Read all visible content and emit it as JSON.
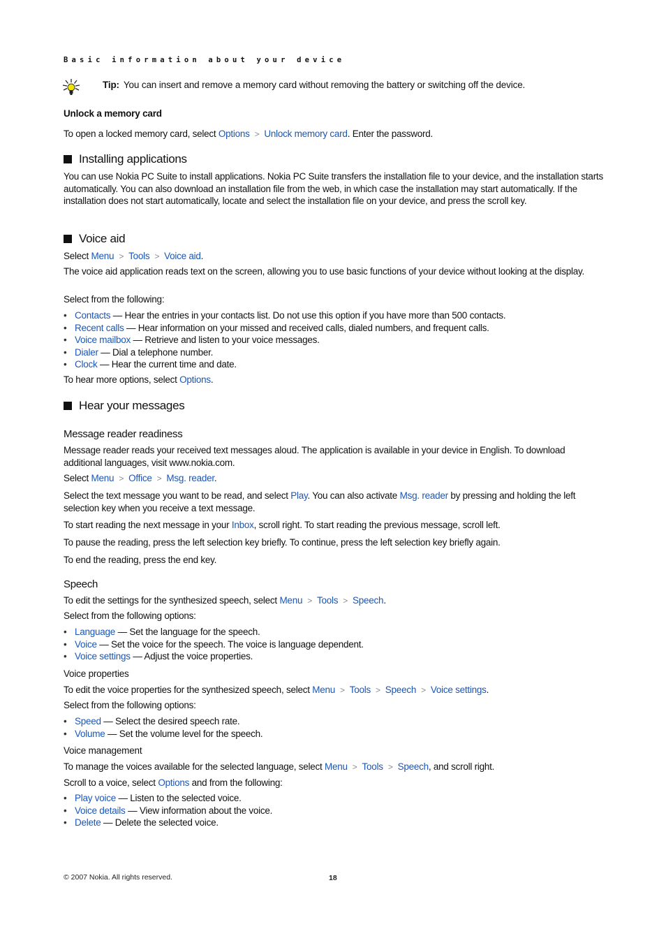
{
  "running_head": "Basic information about your device",
  "tip": {
    "icon": "lightbulb-icon",
    "label": "Tip:",
    "text": "You can insert and remove a memory card without removing the battery or switching off the device."
  },
  "unlock": {
    "heading": "Unlock a memory card",
    "pre": "To open a locked memory card, select ",
    "path": [
      "Options",
      "Unlock memory card"
    ],
    "post": ". Enter the password."
  },
  "installing": {
    "heading": "Installing applications",
    "body": "You can use Nokia PC Suite to install applications. Nokia PC Suite transfers the installation file to your device, and the installation starts automatically. You can also download an installation file from the web, in which case the installation may start automatically. If the installation does not start automatically, locate and select the installation file on your device, and press the scroll key."
  },
  "voice_aid": {
    "heading": "Voice aid",
    "select_pre": "Select ",
    "path": [
      "Menu",
      "Tools",
      "Voice aid"
    ],
    "select_post": ".",
    "description": "The voice aid application reads text on the screen, allowing you to use basic functions of your device without looking at the display.",
    "select_from": "Select from the following:",
    "items": [
      {
        "term": "Contacts",
        "desc": " — Hear the entries in your contacts list. Do not use this option if you have more than 500 contacts."
      },
      {
        "term": "Recent calls",
        "desc": " — Hear information on your missed and received calls, dialed numbers, and frequent calls."
      },
      {
        "term": "Voice mailbox",
        "desc": " — Retrieve and listen to your voice messages."
      },
      {
        "term": "Dialer",
        "desc": " — Dial a telephone number."
      },
      {
        "term": "Clock",
        "desc": " — Hear the current time and date."
      }
    ],
    "more_pre": "To hear more options, select ",
    "more_link": "Options",
    "more_post": "."
  },
  "hear_messages": {
    "heading": "Hear your messages",
    "readiness": {
      "heading": "Message reader readiness",
      "body": "Message reader reads your received text messages aloud. The application is available in your device in English. To download additional languages, visit www.nokia.com.",
      "select_pre": "Select ",
      "path": [
        "Menu",
        "Office",
        "Msg. reader"
      ],
      "select_post": "."
    },
    "p1": {
      "a": "Select the text message you want to be read, and select ",
      "l1": "Play",
      "b": ". You can also activate ",
      "l2": "Msg. reader",
      "c": " by pressing and holding the left selection key when you receive a text message."
    },
    "p2": {
      "a": "To start reading the next message in your ",
      "l1": "Inbox",
      "b": ", scroll right. To start reading the previous message, scroll left."
    },
    "p3": "To pause the reading, press the left selection key briefly. To continue, press the left selection key briefly again.",
    "p4": "To end the reading, press the end key."
  },
  "speech": {
    "heading": "Speech",
    "intro_pre": "To edit the settings for the synthesized speech, select ",
    "path": [
      "Menu",
      "Tools",
      "Speech"
    ],
    "intro_post": ".",
    "select_from": "Select from the following options:",
    "items": [
      {
        "term": "Language",
        "desc": " — Set the language for the speech."
      },
      {
        "term": "Voice",
        "desc": " — Set the voice for the speech. The voice is language dependent."
      },
      {
        "term": "Voice settings",
        "desc": " — Adjust the voice properties."
      }
    ]
  },
  "voice_properties": {
    "heading": "Voice properties",
    "intro_pre": "To edit the voice properties for the synthesized speech, select ",
    "path": [
      "Menu",
      "Tools",
      "Speech",
      "Voice settings"
    ],
    "intro_post": ".",
    "select_from": "Select from the following options:",
    "items": [
      {
        "term": "Speed",
        "desc": " — Select the desired speech rate."
      },
      {
        "term": "Volume",
        "desc": " — Set the volume level for the speech."
      }
    ]
  },
  "voice_management": {
    "heading": "Voice management",
    "intro_pre": "To manage the voices available for the selected language, select ",
    "path": [
      "Menu",
      "Tools",
      "Speech"
    ],
    "intro_post": ", and scroll right.",
    "scroll_pre": "Scroll to a voice, select ",
    "scroll_link": "Options",
    "scroll_post": " and from the following:",
    "items": [
      {
        "term": "Play voice",
        "desc": " — Listen to the selected voice."
      },
      {
        "term": "Voice details",
        "desc": " — View information about the voice."
      },
      {
        "term": "Delete",
        "desc": " — Delete the selected voice."
      }
    ]
  },
  "footer": {
    "copyright": "© 2007 Nokia. All rights reserved.",
    "page_number": "18"
  },
  "colors": {
    "link": "#1a56b8",
    "text": "#111111",
    "chevron": "#8a8a8a"
  }
}
